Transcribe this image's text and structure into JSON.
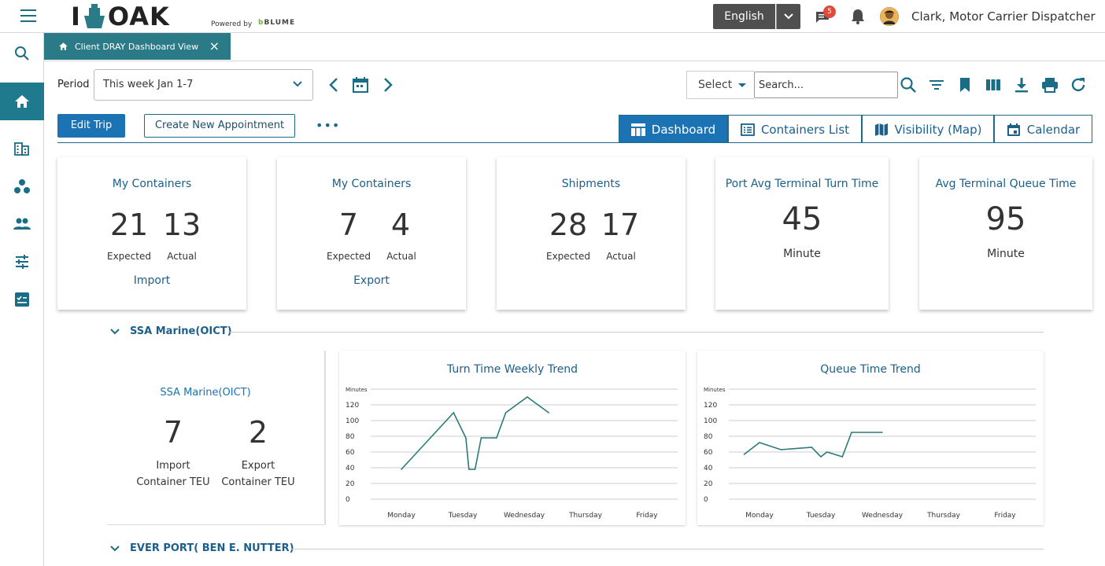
{
  "app": {
    "logo_text": "OAK",
    "logo_prefix": "I",
    "powered_by": "Powered by",
    "brand": "BLUME",
    "language": "English",
    "notification_count": "5",
    "user_name": "Clark, Motor Carrier Dispatcher"
  },
  "tab": {
    "label": "Client DRAY Dashboard View"
  },
  "toolbar": {
    "period_label": "Period",
    "period_value": "This week Jan 1-7",
    "select_label": "Select",
    "search_placeholder": "Search..."
  },
  "actions": {
    "edit_trip": "Edit Trip",
    "create_appointment": "Create New Appointment",
    "more": "•••"
  },
  "view_tabs": [
    {
      "label": "Dashboard",
      "active": true
    },
    {
      "label": "Containers List",
      "active": false
    },
    {
      "label": "Visibility (Map)",
      "active": false
    },
    {
      "label": "Calendar",
      "active": false
    }
  ],
  "cards": [
    {
      "title": "My Containers",
      "expected": "21",
      "actual": "13",
      "expected_label": "Expected",
      "actual_label": "Actual",
      "link": "Import"
    },
    {
      "title": "My Containers",
      "expected": "7",
      "actual": "4",
      "expected_label": "Expected",
      "actual_label": "Actual",
      "link": "Export"
    },
    {
      "title": "Shipments",
      "expected": "28",
      "actual": "17",
      "expected_label": "Expected",
      "actual_label": "Actual"
    },
    {
      "title": "Port Avg Terminal Turn Time",
      "value": "45",
      "unit": "Minute"
    },
    {
      "title": "Avg Terminal Queue Time",
      "value": "95",
      "unit": "Minute"
    }
  ],
  "sections": [
    {
      "name": "SSA Marine(OICT)"
    },
    {
      "name": "EVER PORT( BEN E. NUTTER)"
    }
  ],
  "terminal": {
    "title": "SSA Marine(OICT)",
    "import_value": "7",
    "export_value": "2",
    "import_label_1": "Import",
    "import_label_2": "Container TEU",
    "export_label_1": "Export",
    "export_label_2": "Container TEU"
  },
  "colors": {
    "accent": "#1b73b4",
    "teal": "#1e7a8c",
    "line": "#2a7a7a"
  },
  "chart_data": [
    {
      "type": "line",
      "title": "Turn Time Weekly Trend",
      "ylabel": "Minutes",
      "ylim": [
        0,
        120
      ],
      "yticks": [
        0,
        20,
        40,
        60,
        80,
        100,
        120
      ],
      "categories": [
        "Monday",
        "Tuesday",
        "Wednesday",
        "Thursday",
        "Friday"
      ],
      "points": [
        [
          0,
          38
        ],
        [
          0.85,
          110
        ],
        [
          1.05,
          78
        ],
        [
          1.1,
          38
        ],
        [
          1.2,
          38
        ],
        [
          1.3,
          78
        ],
        [
          1.55,
          78
        ],
        [
          1.7,
          110
        ],
        [
          2.05,
          130
        ],
        [
          2.4,
          110
        ]
      ]
    },
    {
      "type": "line",
      "title": "Queue Time Trend",
      "ylabel": "Minutes",
      "ylim": [
        0,
        120
      ],
      "yticks": [
        0,
        20,
        40,
        60,
        80,
        100,
        120
      ],
      "categories": [
        "Monday",
        "Tuesday",
        "Wednesday",
        "Thursday",
        "Friday"
      ],
      "points": [
        [
          -0.25,
          57
        ],
        [
          0,
          72
        ],
        [
          0.35,
          63
        ],
        [
          0.85,
          66
        ],
        [
          1.0,
          54
        ],
        [
          1.1,
          60
        ],
        [
          1.35,
          54
        ],
        [
          1.5,
          85
        ],
        [
          2.0,
          85
        ]
      ]
    }
  ]
}
